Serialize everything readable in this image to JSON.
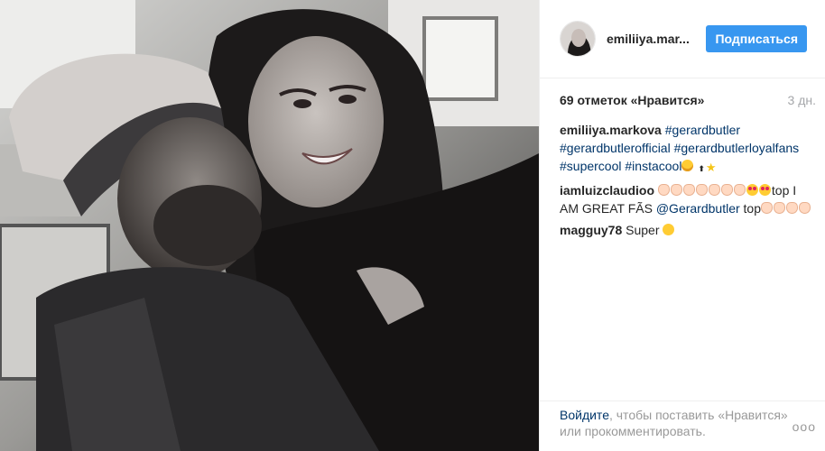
{
  "header": {
    "username": "emiliiya.mar...",
    "follow_label": "Подписаться"
  },
  "meta": {
    "likes": "69 отметок «Нравится»",
    "time": "3 дн."
  },
  "comments": [
    {
      "author": "emiliiya.markova",
      "tags": [
        "#gerardbutler",
        "#gerardbutlerofficial",
        "#gerardbutlerloyalfans",
        "#supercool",
        "#instacool"
      ]
    },
    {
      "author": "iamluizclaudioo",
      "text_1": "top I AM GREAT FÃS",
      "mention": "@Gerardbutler",
      "text_2": "top"
    },
    {
      "author": "magguy78",
      "text": "Super"
    }
  ],
  "footer": {
    "login_link": "Войдите",
    "login_rest": ", чтобы поставить «Нравится» или прокомментировать.",
    "more_icon": "ooo"
  },
  "colors": {
    "accent": "#3897f0",
    "link": "#003569",
    "muted": "#999999"
  },
  "icons": [
    "avatar-image",
    "grin-emoji",
    "top-emoji",
    "star-emoji",
    "clap-emoji",
    "heart-eyes-emoji",
    "sweat-smile-emoji",
    "more-options-icon"
  ]
}
